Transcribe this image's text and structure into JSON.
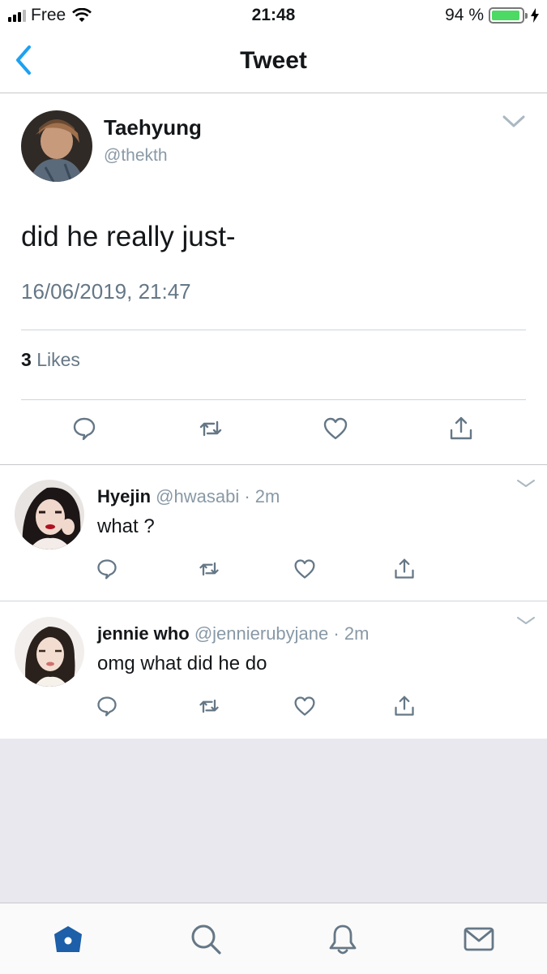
{
  "status_bar": {
    "carrier": "Free",
    "time": "21:48",
    "battery": "94 %",
    "battery_level": 0.94
  },
  "nav": {
    "title": "Tweet",
    "back_icon": "chevron-left-icon"
  },
  "tweet": {
    "author_name": "Taehyung",
    "author_handle": "@thekth",
    "text": "did he really just-",
    "timestamp": "16/06/2019, 21:47",
    "likes_count": "3",
    "likes_label": "Likes"
  },
  "replies": [
    {
      "name": "Hyejin",
      "handle": "@hwasabi",
      "time": "2m",
      "text": "what ?"
    },
    {
      "name": "jennie who",
      "handle": "@jennierubyjane",
      "time": "2m",
      "text": "omg what did he do"
    }
  ],
  "tab_bar": {
    "icons": [
      "home-icon",
      "search-icon",
      "bell-icon",
      "mail-icon"
    ]
  },
  "colors": {
    "accent": "#1da1f2",
    "icon_gray": "#657786",
    "battery_green": "#4cd964"
  }
}
